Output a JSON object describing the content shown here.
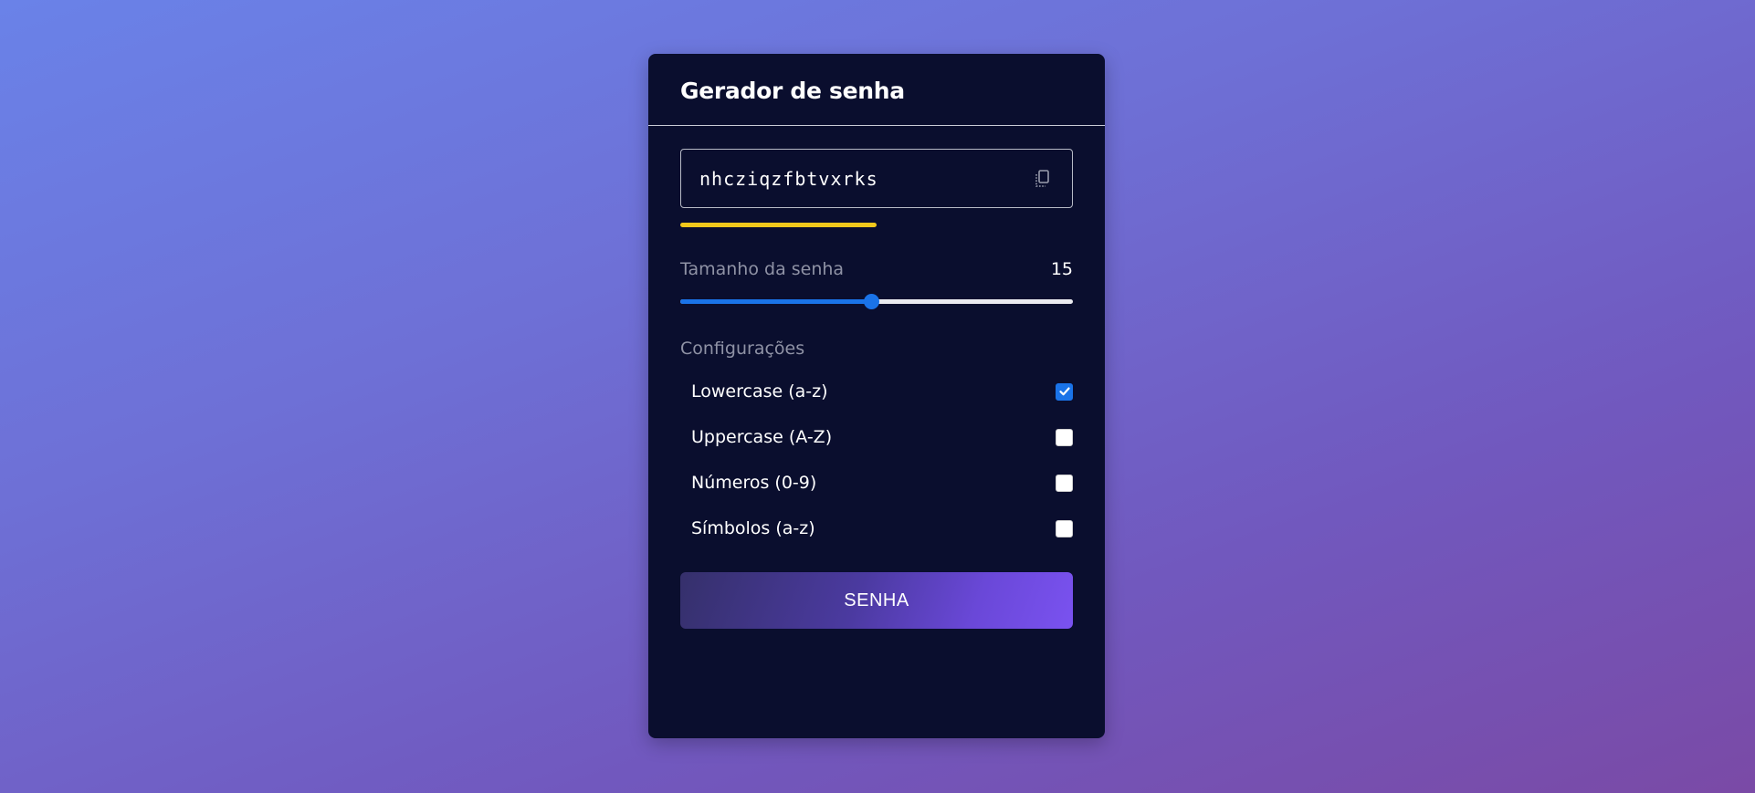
{
  "header": {
    "title": "Gerador de senha"
  },
  "password": {
    "value": "nhcziqzfbtvxrks",
    "copy_icon": "copy-icon",
    "strength_fraction": 0.5,
    "strength_color": "#f2c81b"
  },
  "length": {
    "label": "Tamanho da senha",
    "value": "15",
    "slider_fraction": 0.485,
    "accent_color": "#1a73e8"
  },
  "settings": {
    "label": "Configurações",
    "options": [
      {
        "label": "Lowercase (a-z)",
        "checked": true
      },
      {
        "label": "Uppercase (A-Z)",
        "checked": false
      },
      {
        "label": "Números (0-9)",
        "checked": false
      },
      {
        "label": "Símbolos (a-z)",
        "checked": false
      }
    ]
  },
  "button": {
    "label": "SENHA"
  }
}
